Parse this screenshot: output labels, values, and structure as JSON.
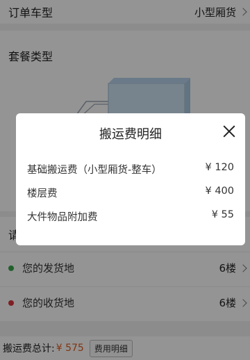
{
  "order": {
    "label": "订单车型",
    "value": "小型厢货"
  },
  "package": {
    "title": "套餐类型"
  },
  "address": {
    "title_partial": "请",
    "send": {
      "label": "您的发货地",
      "floor": "6楼",
      "dot_color": "#3aa54a"
    },
    "recv": {
      "label": "您的收货地",
      "floor": "6楼",
      "dot_color": "#d9363e"
    }
  },
  "bottom": {
    "label": "搬运费总计:",
    "price": "¥ 575",
    "detail_button": "费用明细"
  },
  "modal": {
    "title": "搬运费明细",
    "close_icon": "close-icon",
    "items": [
      {
        "name": "基础搬运费（小型厢货-整车）",
        "amount": "¥ 120"
      },
      {
        "name": "楼层费",
        "amount": "¥ 400"
      },
      {
        "name": "大件物品附加费",
        "amount": "¥ 55"
      }
    ]
  }
}
